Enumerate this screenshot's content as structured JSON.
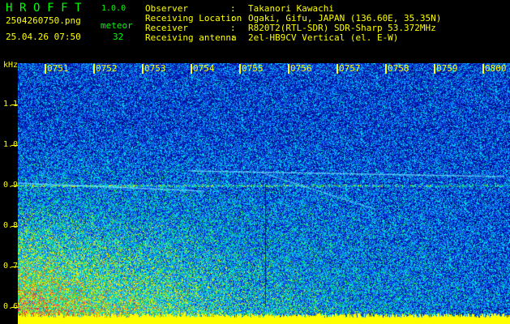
{
  "header": {
    "app_name": "HROFFT",
    "version": "1.0.0",
    "filename": "2504260750.png",
    "datetime": "25.04.26 07:50",
    "count_label": "meteor",
    "count_value": "32"
  },
  "station": [
    {
      "label": "Observer",
      "value": "Takanori Kawachi"
    },
    {
      "label": "Receiving Location",
      "value": "Ogaki, Gifu, JAPAN (136.60E, 35.35N)"
    },
    {
      "label": "Receiver",
      "value": "R820T2(RTL-SDR) SDR-Sharp 53.372MHz"
    },
    {
      "label": "Receiving antenna",
      "value": "2el-HB9CV Vertical (el. E-W)"
    }
  ],
  "separator": ":",
  "y_axis": {
    "unit": "kHz",
    "ticks": [
      "1.1",
      "1.0",
      "0.9",
      "0.8",
      "0.7",
      "0.6"
    ]
  },
  "x_axis": {
    "ticks": [
      "0751",
      "0752",
      "0753",
      "0754",
      "0755",
      "0756",
      "0757",
      "0758",
      "0759",
      "0800"
    ]
  },
  "colors": {
    "background": "#000000",
    "text_yellow": "#ffff00",
    "text_green": "#00ff00",
    "spectrogram_base": "#000c8c"
  }
}
